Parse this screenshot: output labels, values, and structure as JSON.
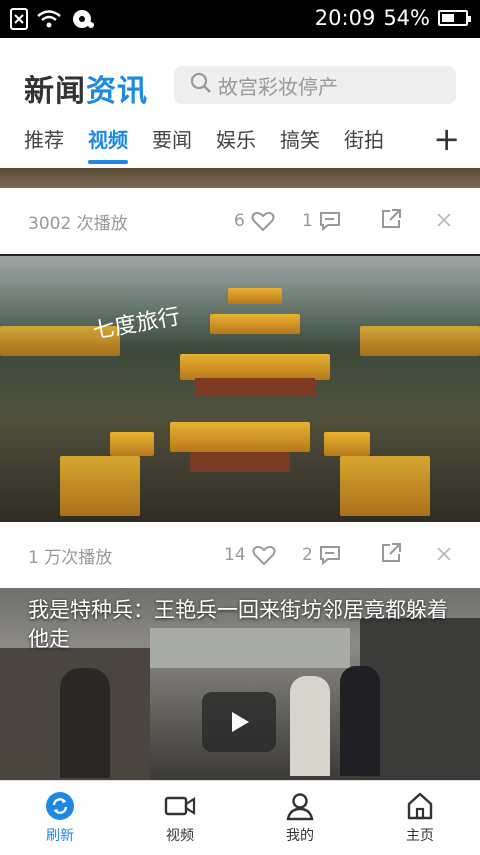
{
  "status_bar": {
    "time": "20:09",
    "battery": "54%",
    "battery_level": 0.54,
    "icons": [
      "sim-off-icon",
      "wifi-icon",
      "hotspot-icon"
    ]
  },
  "header": {
    "logo_text_a": "新闻",
    "logo_text_b": "资讯",
    "search_placeholder": "故宫彩妆停产"
  },
  "tabs": [
    "推荐",
    "视频",
    "要闻",
    "娱乐",
    "搞笑",
    "街拍"
  ],
  "active_tab": 1,
  "feed": {
    "item1": {
      "views": "3002 次播放",
      "likes": "6",
      "comments": "1"
    },
    "item2": {
      "views": "1 万次播放",
      "likes": "14",
      "comments": "2",
      "watermark": "七度旅行"
    },
    "item3": {
      "title": "我是特种兵：王艳兵一回来街坊邻居竟都躲着他走"
    }
  },
  "bottom_nav": [
    {
      "label": "刷新",
      "icon": "refresh-icon",
      "active": true
    },
    {
      "label": "视频",
      "icon": "video-camera-icon",
      "active": false
    },
    {
      "label": "我的",
      "icon": "user-icon",
      "active": false
    },
    {
      "label": "主页",
      "icon": "home-icon",
      "active": false
    }
  ],
  "colors": {
    "accent": "#1e88e5"
  }
}
